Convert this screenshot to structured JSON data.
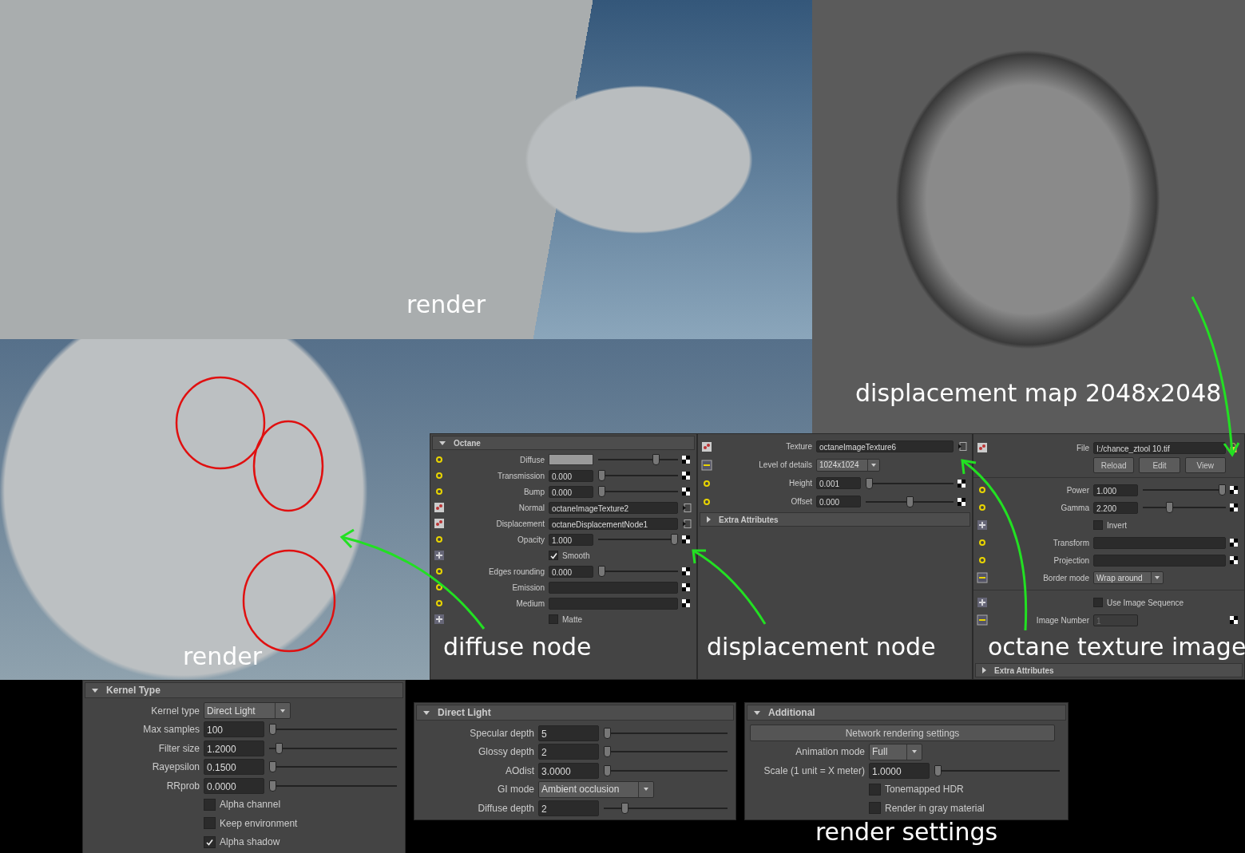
{
  "render_top": {
    "caption": "render"
  },
  "displacement_map": {
    "caption": "displacement map 2048x2048"
  },
  "render_bottom": {
    "caption": "render"
  },
  "material_panel": {
    "header": {
      "title": "Octane",
      "expanded": true
    },
    "caption": "diffuse node",
    "rows": [
      {
        "kind": "color",
        "label": "Diffuse",
        "level": 0.75
      },
      {
        "kind": "slider",
        "label": "Transmission",
        "value": "0.000",
        "level": 0
      },
      {
        "kind": "slider",
        "label": "Bump",
        "value": "0.000",
        "level": 0
      },
      {
        "kind": "link",
        "label": "Normal",
        "value": "octaneImageTexture2"
      },
      {
        "kind": "link",
        "label": "Displacement",
        "value": "octaneDisplacementNode1"
      },
      {
        "kind": "slider",
        "label": "Opacity",
        "value": "1.000",
        "level": 1
      },
      {
        "kind": "checkbox",
        "label": "Smooth",
        "checked": true
      },
      {
        "kind": "slider",
        "label": "Edges rounding",
        "value": "0.000",
        "level": 0
      },
      {
        "kind": "empty",
        "label": "Emission"
      },
      {
        "kind": "empty",
        "label": "Medium"
      },
      {
        "kind": "checkbox",
        "label": "Matte",
        "checked": false
      }
    ]
  },
  "displacement_panel": {
    "caption": "displacement node",
    "rows": [
      {
        "kind": "link",
        "label": "Texture",
        "value": "octaneImageTexture6"
      },
      {
        "kind": "dropdown",
        "label": "Level of details",
        "value": "1024x1024"
      },
      {
        "kind": "slider",
        "label": "Height",
        "value": "0.001",
        "level": 0
      },
      {
        "kind": "slider",
        "label": "Offset",
        "value": "0.000",
        "level": 0.5
      }
    ],
    "extra": {
      "title": "Extra Attributes",
      "expanded": false
    }
  },
  "texture_panel": {
    "caption": "octane texture image",
    "groups": [
      {
        "rows": [
          {
            "kind": "file",
            "label": "File",
            "value": "I:/chance_ztool 10.tif"
          },
          {
            "kind": "buttons",
            "buttons": [
              "Reload",
              "Edit",
              "View"
            ]
          }
        ]
      },
      {
        "rows": [
          {
            "kind": "slider",
            "label": "Power",
            "value": "1.000",
            "level": 1
          },
          {
            "kind": "slider",
            "label": "Gamma",
            "value": "2.200",
            "level": 0.3
          },
          {
            "kind": "checkbox",
            "label": "Invert",
            "checked": false
          },
          {
            "kind": "empty",
            "label": "Transform"
          },
          {
            "kind": "empty",
            "label": "Projection"
          },
          {
            "kind": "dropdown",
            "label": "Border mode",
            "value": "Wrap around"
          }
        ]
      },
      {
        "rows": [
          {
            "kind": "checkbox",
            "label": "Use Image Sequence",
            "checked": false
          },
          {
            "kind": "number",
            "label": "Image Number",
            "value": "1",
            "disabled": true
          }
        ]
      }
    ],
    "extra": {
      "title": "Extra Attributes",
      "expanded": false
    }
  },
  "render_settings": {
    "caption": "render settings",
    "panels": [
      {
        "title": "Kernel Type",
        "expanded": true,
        "rows": [
          {
            "kind": "dropdown",
            "label": "Kernel type",
            "value": "Direct Light"
          },
          {
            "kind": "slider",
            "label": "Max samples",
            "value": "100",
            "level": 0
          },
          {
            "kind": "slider",
            "label": "Filter size",
            "value": "1.2000",
            "level": 0.05
          },
          {
            "kind": "slider",
            "label": "Rayepsilon",
            "value": "0.1500",
            "level": 0
          },
          {
            "kind": "slider",
            "label": "RRprob",
            "value": "0.0000",
            "level": 0
          },
          {
            "kind": "checkbox",
            "label": "Alpha channel",
            "checked": false
          },
          {
            "kind": "checkbox",
            "label": "Keep environment",
            "checked": false
          },
          {
            "kind": "checkbox",
            "label": "Alpha shadow",
            "checked": true
          }
        ]
      },
      {
        "title": "Direct Light",
        "expanded": true,
        "rows": [
          {
            "kind": "slider",
            "label": "Specular depth",
            "value": "5",
            "level": 0
          },
          {
            "kind": "slider",
            "label": "Glossy depth",
            "value": "2",
            "level": 0
          },
          {
            "kind": "slider",
            "label": "AOdist",
            "value": "3.0000",
            "level": 0
          },
          {
            "kind": "dropdown",
            "label": "GI mode",
            "value": "Ambient occlusion"
          },
          {
            "kind": "slider",
            "label": "Diffuse depth",
            "value": "2",
            "level": 0.15
          }
        ]
      },
      {
        "title": "Additional",
        "expanded": true,
        "rows": [
          {
            "kind": "button",
            "label": "Network rendering settings"
          },
          {
            "kind": "dropdown",
            "label": "Animation mode",
            "value": "Full"
          },
          {
            "kind": "slider",
            "label": "Scale (1 unit = X meter)",
            "value": "1.0000",
            "level": 0
          },
          {
            "kind": "checkbox",
            "label": "Tonemapped HDR",
            "checked": false
          },
          {
            "kind": "checkbox",
            "label": "Render in gray material",
            "checked": false
          }
        ]
      }
    ]
  }
}
